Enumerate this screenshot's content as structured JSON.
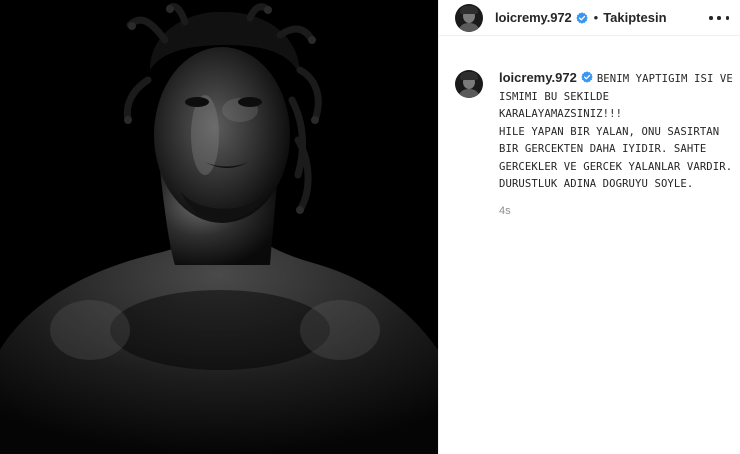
{
  "post": {
    "photo": {
      "alt": "",
      "icon": "portrait-photo"
    },
    "header": {
      "username": "loicremy.972",
      "verified": true,
      "separator": "•",
      "follow_status": "Takiptesin",
      "more_icon": "more-horizontal-icon"
    },
    "caption": {
      "username": "loicremy.972",
      "verified": true,
      "text": "BENIM YAPTIGIM ISI VE ISMIMI BU SEKILDE KARALAYAMAZSINIZ!!!\nHILE YAPAN BIR YALAN, ONU SASIRTAN BIR GERCEKTEN DAHA IYIDIR. SAHTE GERCEKLER VE GERCEK YALANLAR VARDIR.\nDURUSTLUK ADINA DOGRUYU SOYLE.",
      "timestamp": "4s"
    },
    "colors": {
      "verified": "#3897f0",
      "text": "#262626",
      "muted": "#8e8e8e",
      "border": "#efefef"
    }
  }
}
